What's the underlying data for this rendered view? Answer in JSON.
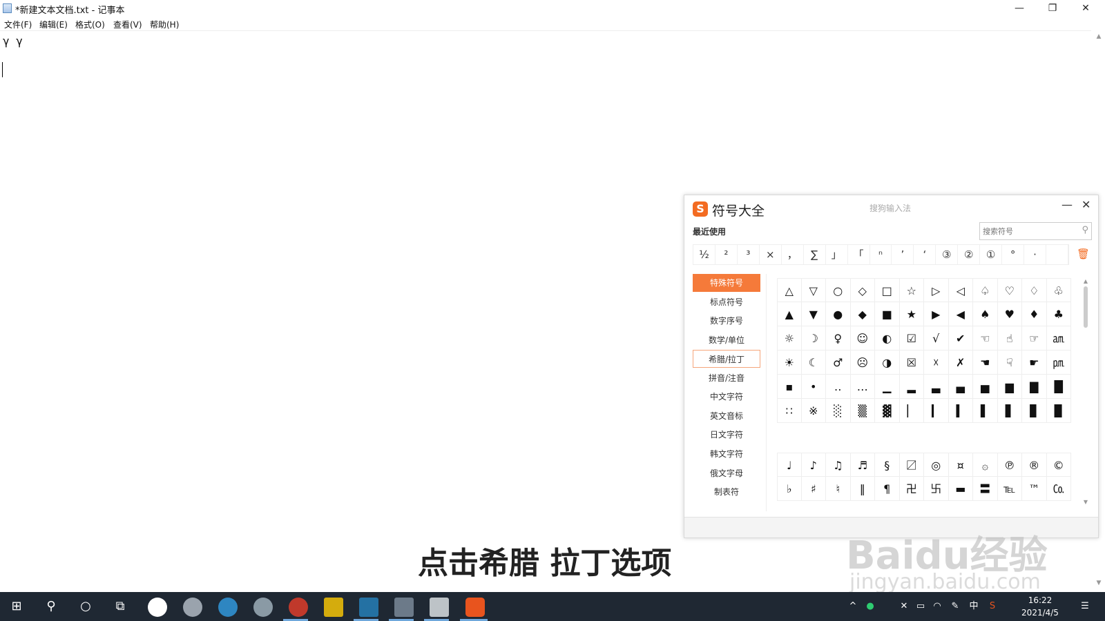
{
  "window": {
    "title": "*新建文本文档.txt - 记事本",
    "controls": {
      "minimize": "—",
      "maximize": "❐",
      "close": "✕"
    }
  },
  "menu": [
    "文件(F)",
    "编辑(E)",
    "格式(O)",
    "查看(V)",
    "帮助(H)"
  ],
  "editor": {
    "text": "γ γ"
  },
  "symbol_panel": {
    "logo": "S",
    "title": "符号大全",
    "subtitle": "搜狗输入法",
    "minimize": "—",
    "close": "✕",
    "recent_label": "最近使用",
    "search_placeholder": "搜索符号",
    "recent": [
      "½",
      "²",
      "³",
      "×",
      "，",
      "∑",
      "」",
      "「",
      "ⁿ",
      "’",
      "‘",
      "③",
      "②",
      "①",
      "°",
      "·",
      ""
    ],
    "categories": [
      "特殊符号",
      "标点符号",
      "数字序号",
      "数学/单位",
      "希腊/拉丁",
      "拼音/注音",
      "中文字符",
      "英文音标",
      "日文字符",
      "韩文字符",
      "俄文字母",
      "制表符"
    ],
    "active_category": "特殊符号",
    "hover_category": "希腊/拉丁",
    "grid1": [
      [
        "△",
        "▽",
        "○",
        "◇",
        "□",
        "☆",
        "▷",
        "◁",
        "♤",
        "♡",
        "♢",
        "♧"
      ],
      [
        "▲",
        "▼",
        "●",
        "◆",
        "■",
        "★",
        "▶",
        "◀",
        "♠",
        "♥",
        "♦",
        "♣"
      ],
      [
        "☼",
        "☽",
        "♀",
        "☺",
        "◐",
        "☑",
        "√",
        "✔",
        "☜",
        "☝",
        "☞",
        "㏂"
      ],
      [
        "☀",
        "☾",
        "♂",
        "☹",
        "◑",
        "☒",
        "☓",
        "✗",
        "☚",
        "☟",
        "☛",
        "㏘"
      ],
      [
        "▪",
        "•",
        "‥",
        "…",
        "▁",
        "▂",
        "▃",
        "▄",
        "▅",
        "▆",
        "▇",
        "█"
      ],
      [
        "∷",
        "※",
        "░",
        "▒",
        "▓",
        "▏",
        "▎",
        "▍",
        "▌",
        "▋",
        "▊",
        "▉"
      ]
    ],
    "grid2": [
      [
        "♩",
        "♪",
        "♫",
        "♬",
        "§",
        "〼",
        "◎",
        "¤",
        "۞",
        "℗",
        "®",
        "©"
      ],
      [
        "♭",
        "♯",
        "♮",
        "‖",
        "¶",
        "卍",
        "卐",
        "▬",
        "〓",
        "℡",
        "™",
        "㏇"
      ]
    ]
  },
  "subtitle": "点击希腊 拉丁选项",
  "watermark": {
    "brand": "Baidu经验",
    "url": "jingyan.baidu.com"
  },
  "taskbar": {
    "tray_lang": "中",
    "time": "16:22",
    "date": "2021/4/5"
  }
}
